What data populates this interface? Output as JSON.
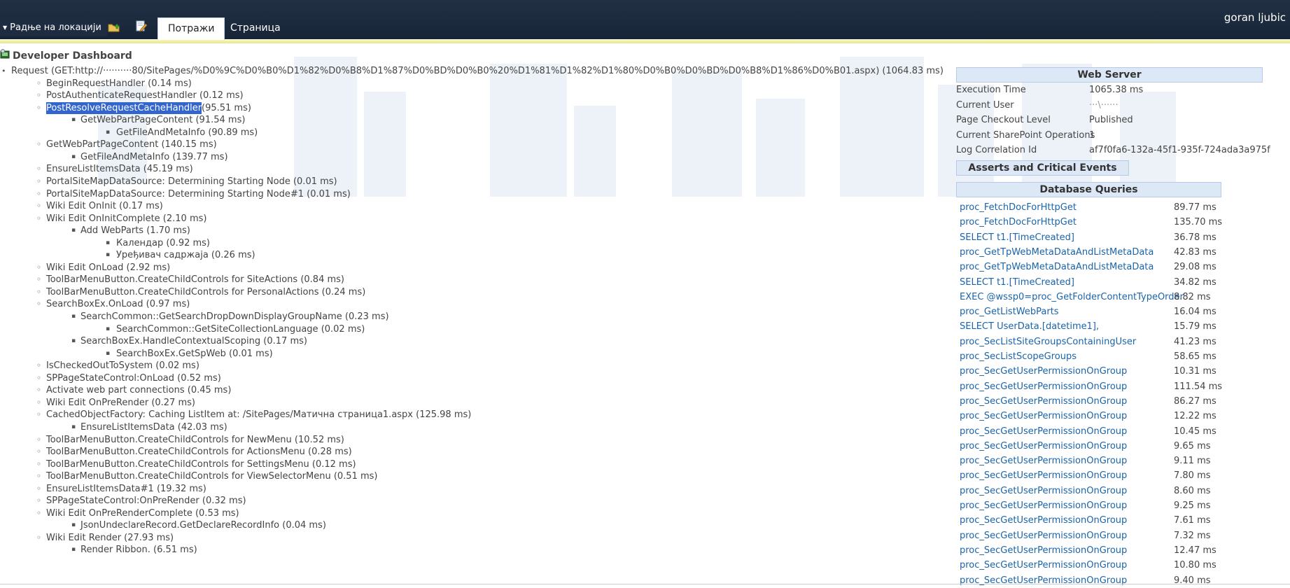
{
  "ribbon": {
    "site_actions": "Радње на локацији",
    "tabs": [
      {
        "label": "Потражи",
        "active": true
      },
      {
        "label": "Страница",
        "active": false
      }
    ],
    "user": "goran ljubic",
    "accent_color": "#1b2a3d"
  },
  "dashboard": {
    "title": "Developer Dashboard",
    "request": "Request (GET:http://··········80/SitePages/%D0%9C%D0%B0%D1%82%D0%B8%D1%87%D0%BD%D0%B0%20%D1%81%D1%82%D1%80%D0%B0%D0%BD%D0%B8%D1%86%D0%B01.aspx) (1064.83 ms)",
    "tree": [
      {
        "level": 1,
        "text": "BeginRequestHandler (0.14 ms)"
      },
      {
        "level": 1,
        "text": "PostAuthenticateRequestHandler (0.12 ms)"
      },
      {
        "level": 1,
        "text": "PostResolveRequestCacheHandler",
        "suffix": " (95.51 ms)",
        "selected": true
      },
      {
        "level": 2,
        "text": "GetWebPartPageContent (91.54 ms)"
      },
      {
        "level": 3,
        "text": "GetFileAndMetaInfo (90.89 ms)"
      },
      {
        "level": 1,
        "text": "GetWebPartPageContent (140.15 ms)"
      },
      {
        "level": 2,
        "text": "GetFileAndMetaInfo (139.77 ms)"
      },
      {
        "level": 1,
        "text": "EnsureListItemsData (45.19 ms)"
      },
      {
        "level": 1,
        "text": "PortalSiteMapDataSource: Determining Starting Node (0.01 ms)"
      },
      {
        "level": 1,
        "text": "PortalSiteMapDataSource: Determining Starting Node#1 (0.01 ms)"
      },
      {
        "level": 1,
        "text": "Wiki Edit OnInit (0.17 ms)"
      },
      {
        "level": 1,
        "text": "Wiki Edit OnInitComplete (2.10 ms)"
      },
      {
        "level": 2,
        "text": "Add WebParts (1.70 ms)"
      },
      {
        "level": 3,
        "text": "Календар (0.92 ms)"
      },
      {
        "level": 3,
        "text": "Уређивач садржаја (0.26 ms)"
      },
      {
        "level": 1,
        "text": "Wiki Edit OnLoad (2.92 ms)"
      },
      {
        "level": 1,
        "text": "ToolBarMenuButton.CreateChildControls for SiteActions (0.84 ms)"
      },
      {
        "level": 1,
        "text": "ToolBarMenuButton.CreateChildControls for PersonalActions (0.24 ms)"
      },
      {
        "level": 1,
        "text": "SearchBoxEx.OnLoad (0.97 ms)"
      },
      {
        "level": 2,
        "text": "SearchCommon::GetSearchDropDownDisplayGroupName (0.23 ms)"
      },
      {
        "level": 3,
        "text": "SearchCommon::GetSiteCollectionLanguage (0.02 ms)"
      },
      {
        "level": 2,
        "text": "SearchBoxEx.HandleContextualScoping (0.17 ms)"
      },
      {
        "level": 3,
        "text": "SearchBoxEx.GetSpWeb (0.01 ms)"
      },
      {
        "level": 1,
        "text": "IsCheckedOutToSystem (0.02 ms)"
      },
      {
        "level": 1,
        "text": "SPPageStateControl:OnLoad (0.52 ms)"
      },
      {
        "level": 1,
        "text": "Activate web part connections (0.45 ms)"
      },
      {
        "level": 1,
        "text": "Wiki Edit OnPreRender (0.27 ms)"
      },
      {
        "level": 1,
        "text": "CachedObjectFactory: Caching ListItem at: /SitePages/Матична страница1.aspx (125.98 ms)"
      },
      {
        "level": 2,
        "text": "EnsureListItemsData (42.03 ms)"
      },
      {
        "level": 1,
        "text": "ToolBarMenuButton.CreateChildControls for NewMenu (10.52 ms)"
      },
      {
        "level": 1,
        "text": "ToolBarMenuButton.CreateChildControls for ActionsMenu (0.28 ms)"
      },
      {
        "level": 1,
        "text": "ToolBarMenuButton.CreateChildControls for SettingsMenu (0.12 ms)"
      },
      {
        "level": 1,
        "text": "ToolBarMenuButton.CreateChildControls for ViewSelectorMenu (0.51 ms)"
      },
      {
        "level": 1,
        "text": "EnsureListItemsData#1 (19.32 ms)"
      },
      {
        "level": 1,
        "text": "SPPageStateControl:OnPreRender (0.32 ms)"
      },
      {
        "level": 1,
        "text": "Wiki Edit OnPreRenderComplete (0.53 ms)"
      },
      {
        "level": 2,
        "text": "JsonUndeclareRecord.GetDeclareRecordInfo (0.04 ms)"
      },
      {
        "level": 1,
        "text": "Wiki Edit Render (27.93 ms)"
      },
      {
        "level": 2,
        "text": "Render Ribbon. (6.51 ms)"
      }
    ]
  },
  "web_server": {
    "header": "Web Server",
    "rows": [
      {
        "key": "Execution Time",
        "value": "1065.38 ms"
      },
      {
        "key": "Current User",
        "value": "···\\······"
      },
      {
        "key": "Page Checkout Level",
        "value": "Published"
      },
      {
        "key": "Current SharePoint Operations",
        "value": "1"
      },
      {
        "key": "Log Correlation Id",
        "value": "af7f0fa6-132a-45f1-935f-724ada3a975f"
      }
    ]
  },
  "asserts": {
    "header": "Asserts and Critical Events"
  },
  "db": {
    "header": "Database Queries",
    "rows": [
      {
        "query": "proc_FetchDocForHttpGet",
        "time": "89.77 ms"
      },
      {
        "query": "proc_FetchDocForHttpGet",
        "time": "135.70 ms"
      },
      {
        "query": "SELECT t1.[TimeCreated]",
        "time": "36.78 ms"
      },
      {
        "query": "proc_GetTpWebMetaDataAndListMetaData",
        "time": "42.83 ms"
      },
      {
        "query": "proc_GetTpWebMetaDataAndListMetaData",
        "time": "29.08 ms"
      },
      {
        "query": "SELECT t1.[TimeCreated]",
        "time": "34.82 ms"
      },
      {
        "query": "EXEC @wssp0=proc_GetFolderContentTypeOrder",
        "time": "8.82 ms"
      },
      {
        "query": "proc_GetListWebParts",
        "time": "16.04 ms"
      },
      {
        "query": "SELECT UserData.[datetime1],",
        "time": "15.79 ms"
      },
      {
        "query": "proc_SecListSiteGroupsContainingUser",
        "time": "41.23 ms"
      },
      {
        "query": "proc_SecListScopeGroups",
        "time": "58.65 ms"
      },
      {
        "query": "proc_SecGetUserPermissionOnGroup",
        "time": "10.31 ms"
      },
      {
        "query": "proc_SecGetUserPermissionOnGroup",
        "time": "111.54 ms"
      },
      {
        "query": "proc_SecGetUserPermissionOnGroup",
        "time": "86.27 ms"
      },
      {
        "query": "proc_SecGetUserPermissionOnGroup",
        "time": "12.22 ms"
      },
      {
        "query": "proc_SecGetUserPermissionOnGroup",
        "time": "10.45 ms"
      },
      {
        "query": "proc_SecGetUserPermissionOnGroup",
        "time": "9.65 ms"
      },
      {
        "query": "proc_SecGetUserPermissionOnGroup",
        "time": "9.11 ms"
      },
      {
        "query": "proc_SecGetUserPermissionOnGroup",
        "time": "7.80 ms"
      },
      {
        "query": "proc_SecGetUserPermissionOnGroup",
        "time": "8.60 ms"
      },
      {
        "query": "proc_SecGetUserPermissionOnGroup",
        "time": "9.25 ms"
      },
      {
        "query": "proc_SecGetUserPermissionOnGroup",
        "time": "7.61 ms"
      },
      {
        "query": "proc_SecGetUserPermissionOnGroup",
        "time": "7.32 ms"
      },
      {
        "query": "proc_SecGetUserPermissionOnGroup",
        "time": "12.47 ms"
      },
      {
        "query": "proc_SecGetUserPermissionOnGroup",
        "time": "10.80 ms"
      },
      {
        "query": "proc_SecGetUserPermissionOnGroup",
        "time": "9.40 ms"
      }
    ]
  }
}
